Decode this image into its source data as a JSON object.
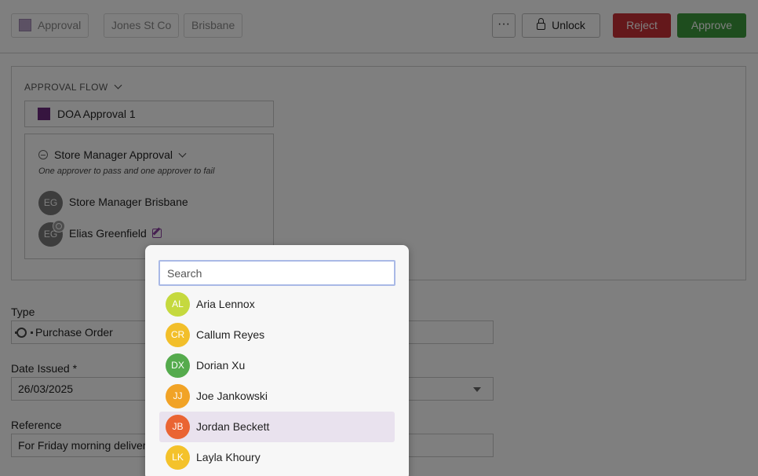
{
  "header": {
    "status_tag": "Approval",
    "company_tag": "Jones St Co",
    "location_tag": "Brisbane",
    "more_label": "···",
    "unlock_label": "Unlock",
    "reject_label": "Reject",
    "approve_label": "Approve"
  },
  "approval_flow": {
    "title": "APPROVAL FLOW",
    "doa_label": "DOA Approval 1",
    "stage": {
      "title": "Store Manager Approval",
      "subtitle": "One approver to pass and one approver to fail",
      "approvers": [
        {
          "initials": "EG",
          "name": "Store Manager Brisbane"
        },
        {
          "initials": "EG",
          "name": "Elias Greenfield"
        }
      ]
    }
  },
  "form": {
    "type_label": "Type",
    "type_value": "Purchase Order",
    "date_label": "Date Issued *",
    "date_value": "26/03/2025",
    "reference_label": "Reference",
    "reference_value": "For Friday morning delivery"
  },
  "dropdown": {
    "search_placeholder": "Search",
    "options": [
      {
        "initials": "AL",
        "name": "Aria Lennox",
        "color": "#c5d93e"
      },
      {
        "initials": "CR",
        "name": "Callum Reyes",
        "color": "#f2bf2a"
      },
      {
        "initials": "DX",
        "name": "Dorian Xu",
        "color": "#55ab4d"
      },
      {
        "initials": "JJ",
        "name": "Joe Jankowski",
        "color": "#f1a326"
      },
      {
        "initials": "JB",
        "name": "Jordan Beckett",
        "color": "#ea6433",
        "highlighted": true
      },
      {
        "initials": "LK",
        "name": "Layla Khoury",
        "color": "#f4c22b"
      }
    ]
  },
  "colors": {
    "reject": "#c93136",
    "approve": "#3c9a3c",
    "doa_swatch": "#6d2b7f",
    "highlight": "#e9e2ee"
  }
}
